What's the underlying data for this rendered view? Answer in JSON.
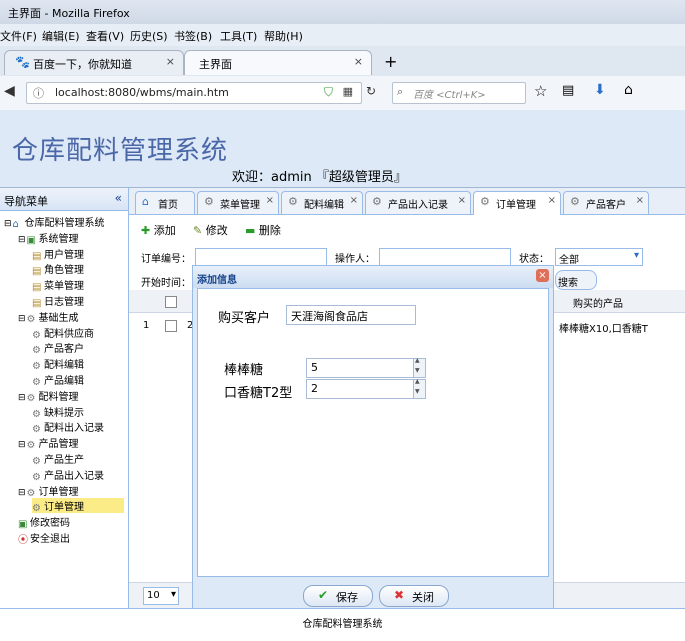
{
  "window": {
    "title": "主界面 - Mozilla Firefox"
  },
  "menubar": [
    "文件(F)",
    "编辑(E)",
    "查看(V)",
    "历史(S)",
    "书签(B)",
    "工具(T)",
    "帮助(H)"
  ],
  "browser_tabs": [
    {
      "label": "百度一下，你就知道",
      "close": "×"
    },
    {
      "label": "主界面",
      "close": "×"
    }
  ],
  "new_tab": "+",
  "urlbar": {
    "url": "localhost:8080/wbms/main.htm",
    "search_placeholder": "百度 <Ctrl+K>"
  },
  "app": {
    "title": "仓库配料管理系统",
    "welcome": "欢迎：admin 『超级管理员』"
  },
  "sidebar": {
    "title": "导航菜单",
    "collapse": "«",
    "tree": [
      {
        "label": "仓库配料管理系统",
        "level": 0,
        "icon": "home-icon"
      },
      {
        "label": "系统管理",
        "level": 1,
        "icon": "folder-icon"
      },
      {
        "label": "用户管理",
        "level": 2,
        "icon": "doc-icon"
      },
      {
        "label": "角色管理",
        "level": 2,
        "icon": "doc-icon"
      },
      {
        "label": "菜单管理",
        "level": 2,
        "icon": "doc-icon"
      },
      {
        "label": "日志管理",
        "level": 2,
        "icon": "doc-icon"
      },
      {
        "label": "基础生成",
        "level": 1,
        "icon": "gear-icon"
      },
      {
        "label": "配料供应商",
        "level": 2,
        "icon": "gear-icon"
      },
      {
        "label": "产品客户",
        "level": 2,
        "icon": "gear-icon"
      },
      {
        "label": "配料编辑",
        "level": 2,
        "icon": "gear-icon"
      },
      {
        "label": "产品编辑",
        "level": 2,
        "icon": "gear-icon"
      },
      {
        "label": "配料管理",
        "level": 1,
        "icon": "gear-icon"
      },
      {
        "label": "缺料提示",
        "level": 2,
        "icon": "gear-icon"
      },
      {
        "label": "配料出入记录",
        "level": 2,
        "icon": "gear-icon"
      },
      {
        "label": "产品管理",
        "level": 1,
        "icon": "gear-icon"
      },
      {
        "label": "产品生产",
        "level": 2,
        "icon": "gear-icon"
      },
      {
        "label": "产品出入记录",
        "level": 2,
        "icon": "gear-icon"
      },
      {
        "label": "订单管理",
        "level": 1,
        "icon": "gear-icon"
      },
      {
        "label": "订单管理",
        "level": 2,
        "icon": "gear-icon",
        "selected": true
      },
      {
        "label": "修改密码",
        "level": 1,
        "icon": "folder-icon"
      },
      {
        "label": "安全退出",
        "level": 1,
        "icon": "exit-icon"
      }
    ]
  },
  "page_tabs": [
    {
      "label": "首页",
      "close": "",
      "icon": "home-icon"
    },
    {
      "label": "菜单管理",
      "close": "×",
      "icon": "gear-icon"
    },
    {
      "label": "配料编辑",
      "close": "×",
      "icon": "gear-icon"
    },
    {
      "label": "产品出入记录",
      "close": "×",
      "icon": "gear-icon"
    },
    {
      "label": "订单管理",
      "close": "×",
      "icon": "gear-icon",
      "active": true
    },
    {
      "label": "产品客户",
      "close": "×",
      "icon": "gear-icon"
    }
  ],
  "toolbar": {
    "add": "添加",
    "edit": "修改",
    "delete": "删除"
  },
  "filters": {
    "order_no_label": "订单编号：",
    "operator_label": "操作人：",
    "status_label": "状态：",
    "status_value": "全部",
    "start_time_label": "开始时间：",
    "search": "搜索"
  },
  "grid": {
    "header_products": "购买的产品",
    "rows": [
      {
        "num": "1",
        "id_partial": "2",
        "products": "棒棒糖X10,口香糖T"
      }
    ]
  },
  "pager": {
    "page_size": "10"
  },
  "dialog": {
    "title": "添加信息",
    "close": "×",
    "customer_label": "购买客户",
    "customer_value": "天涯海阁食品店",
    "fields": [
      {
        "label": "棒棒糖",
        "value": "5"
      },
      {
        "label": "口香糖T2型",
        "value": "2"
      }
    ],
    "save": "保存",
    "cancel": "关闭"
  },
  "footer": "仓库配料管理系统"
}
